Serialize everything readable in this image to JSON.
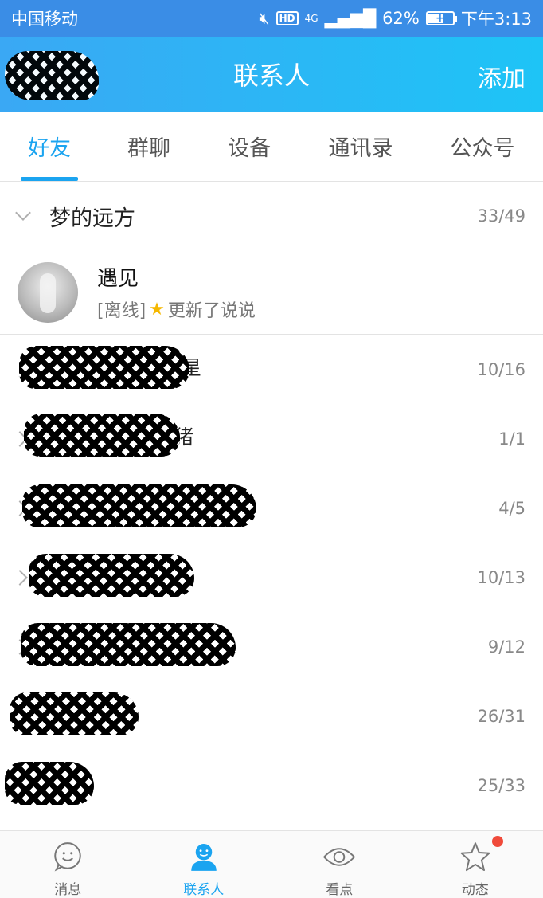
{
  "status_bar": {
    "carrier": "中国移动",
    "network": "4G",
    "hd_badge": "HD",
    "battery": "62%",
    "battery_level": 0.62,
    "time": "下午3:13"
  },
  "header": {
    "title": "联系人",
    "add_label": "添加"
  },
  "tabs": [
    {
      "label": "好友",
      "active": true
    },
    {
      "label": "群聊",
      "active": false
    },
    {
      "label": "设备",
      "active": false
    },
    {
      "label": "通讯录",
      "active": false
    },
    {
      "label": "公众号",
      "active": false
    }
  ],
  "groups": [
    {
      "name": "梦的远方",
      "count": "33/49",
      "expanded": true
    },
    {
      "name": "星",
      "count": "10/16"
    },
    {
      "name": "猪",
      "count": "1/1"
    },
    {
      "name": "",
      "count": "4/5"
    },
    {
      "name": "",
      "count": "10/13"
    },
    {
      "name": "",
      "count": "9/12"
    },
    {
      "name": "",
      "count": "26/31"
    },
    {
      "name": "",
      "count": "25/33"
    }
  ],
  "friend": {
    "name": "遇见",
    "status": "[离线]",
    "update": "更新了说说"
  },
  "bottom_nav": [
    {
      "label": "消息",
      "icon": "smile-icon",
      "active": false
    },
    {
      "label": "联系人",
      "icon": "contact-icon",
      "active": true
    },
    {
      "label": "看点",
      "icon": "eye-icon",
      "active": false
    },
    {
      "label": "动态",
      "icon": "star-icon",
      "active": false,
      "badge": true
    }
  ],
  "colors": {
    "accent": "#1ba4f0",
    "header_start": "#3aa8f4",
    "header_end": "#1ec4f6",
    "badge": "#f04a3a"
  }
}
